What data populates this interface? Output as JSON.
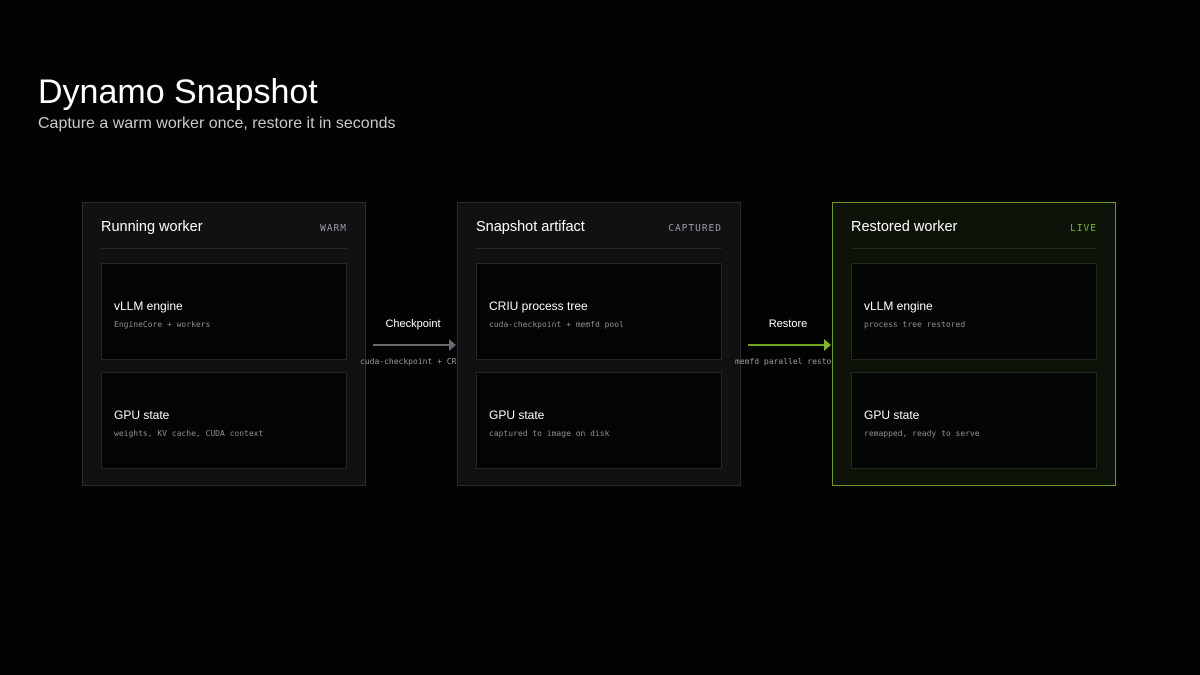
{
  "header": {
    "title": "Dynamo Snapshot",
    "subtitle": "Capture a warm worker once, restore it in seconds"
  },
  "panels": [
    {
      "title": "Running worker",
      "status": "WARM",
      "cards": [
        {
          "title": "vLLM engine",
          "detail": "EngineCore + workers"
        },
        {
          "title": "GPU state",
          "detail": "weights, KV cache, CUDA context"
        }
      ]
    },
    {
      "title": "Snapshot artifact",
      "status": "CAPTURED",
      "cards": [
        {
          "title": "CRIU process tree",
          "detail": "cuda-checkpoint + memfd pool"
        },
        {
          "title": "GPU state",
          "detail": "captured to image on disk"
        }
      ]
    },
    {
      "title": "Restored worker",
      "status": "LIVE",
      "cards": [
        {
          "title": "vLLM engine",
          "detail": "process tree restored"
        },
        {
          "title": "GPU state",
          "detail": "remapped, ready to serve"
        }
      ]
    }
  ],
  "connectors": [
    {
      "label": "Checkpoint",
      "detail": "cuda-checkpoint + CRIU",
      "color": "#6a6a70"
    },
    {
      "label": "Restore",
      "detail": "memfd parallel restore",
      "color": "#7fb62a"
    }
  ],
  "colors": {
    "background": "#030304",
    "accent_green": "#7fb62a",
    "panel_border": "#2b2b2f"
  }
}
